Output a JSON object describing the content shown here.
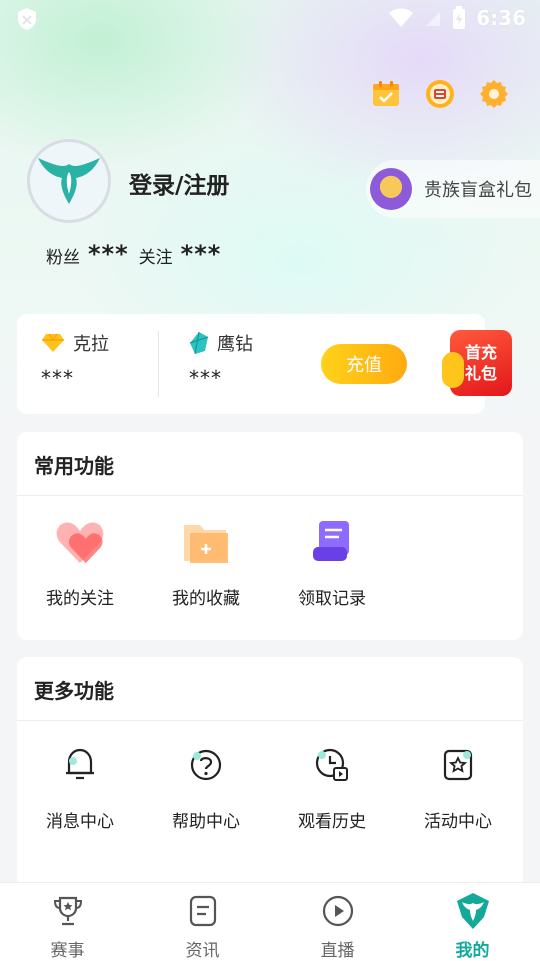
{
  "status_bar": {
    "time": "6:36"
  },
  "profile": {
    "login_label": "登录/注册",
    "fans_label": "粉丝",
    "fans_value": "***",
    "follow_label": "关注",
    "follow_value": "***"
  },
  "gift": {
    "label": "贵族盲盒礼包"
  },
  "wallet": {
    "carat_label": "克拉",
    "carat_value": "***",
    "diamond_label": "鹰钻",
    "diamond_value": "***",
    "recharge_label": "充值",
    "first_charge_line1": "首充",
    "first_charge_line2": "礼包"
  },
  "common": {
    "title": "常用功能",
    "items": [
      {
        "label": "我的关注",
        "icon": "heart-icon"
      },
      {
        "label": "我的收藏",
        "icon": "folder-icon"
      },
      {
        "label": "领取记录",
        "icon": "scroll-icon"
      }
    ]
  },
  "more": {
    "title": "更多功能",
    "items": [
      {
        "label": "消息中心",
        "icon": "bell-icon"
      },
      {
        "label": "帮助中心",
        "icon": "help-icon"
      },
      {
        "label": "观看历史",
        "icon": "history-icon"
      },
      {
        "label": "活动中心",
        "icon": "star-card-icon"
      }
    ]
  },
  "tabs": [
    {
      "label": "赛事",
      "icon": "trophy-icon"
    },
    {
      "label": "资讯",
      "icon": "news-icon"
    },
    {
      "label": "直播",
      "icon": "play-icon"
    },
    {
      "label": "我的",
      "icon": "eagle-icon"
    }
  ],
  "colors": {
    "accent": "#13a99a",
    "recharge": "#ffb614",
    "first_charge": "#e3161a"
  }
}
